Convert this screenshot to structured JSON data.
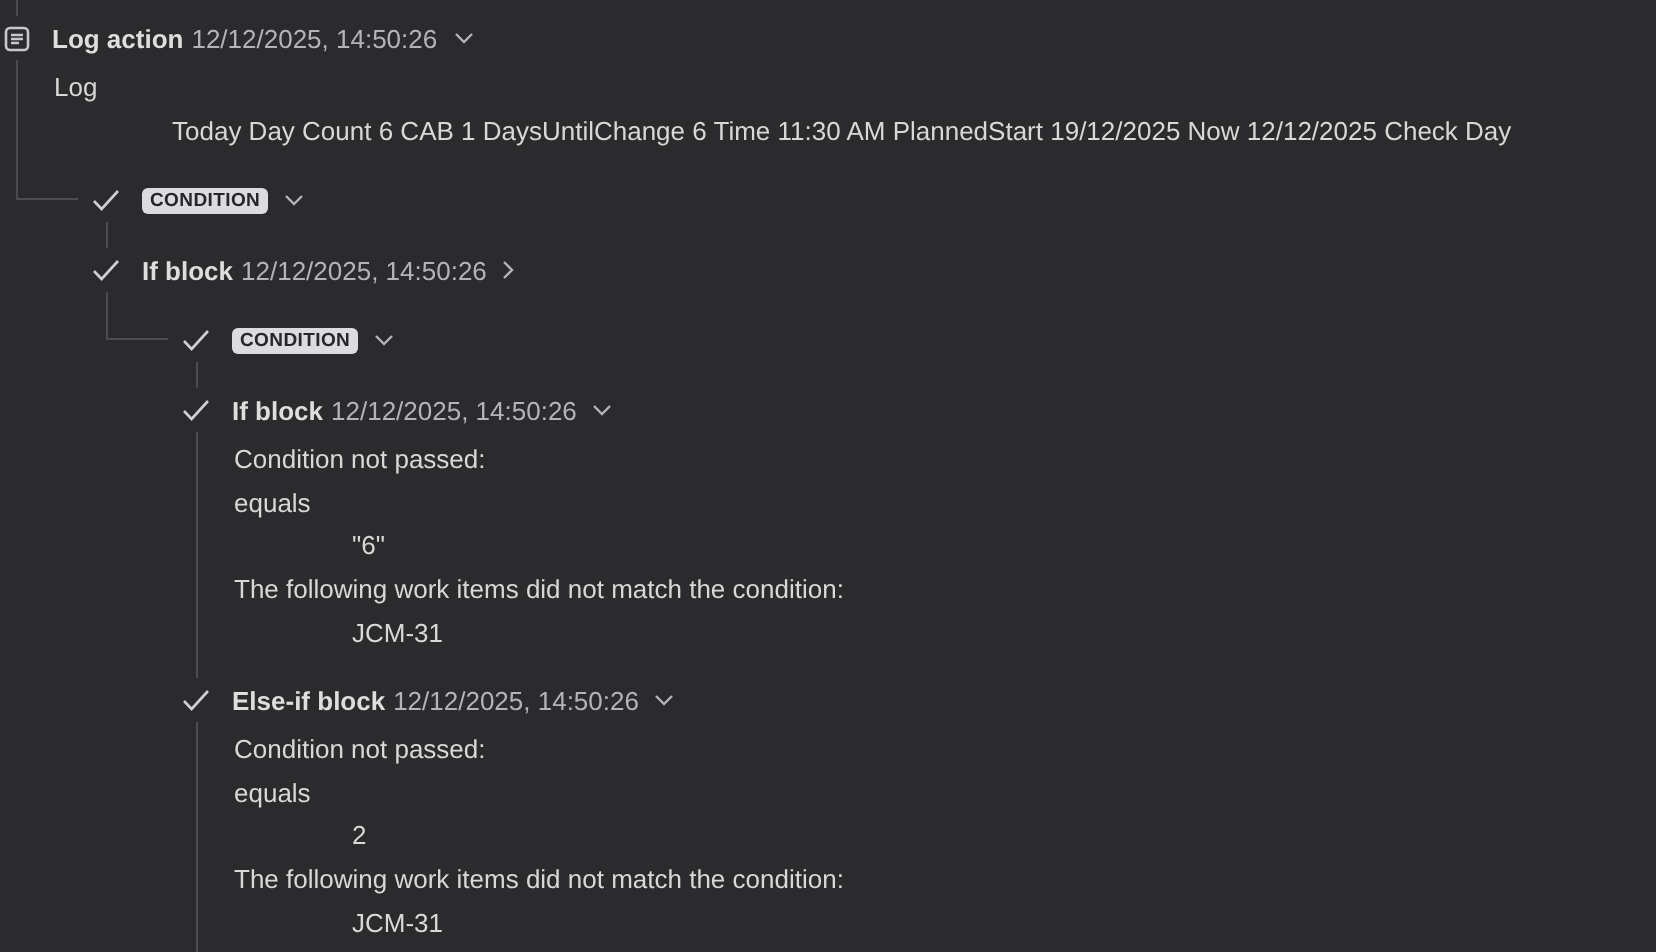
{
  "log": {
    "kind": "log",
    "title": "Log action",
    "timestamp": "12/12/2025, 14:50:26",
    "expanded": true,
    "details": [
      {
        "kind": "text",
        "text": "Log"
      },
      {
        "kind": "value",
        "text": "Today Day Count 6 CAB 1 DaysUntilChange 6 Time 11:30 AM PlannedStart 19/12/2025 Now 12/12/2025 Check Day"
      }
    ],
    "children": [
      {
        "kind": "condition",
        "badge": "CONDITION",
        "expanded": true,
        "children": [
          {
            "kind": "block",
            "title": "If block",
            "timestamp": "12/12/2025, 14:50:26",
            "expanded": false,
            "children": [
              {
                "kind": "condition",
                "badge": "CONDITION",
                "expanded": true,
                "children": [
                  {
                    "kind": "block",
                    "title": "If block",
                    "timestamp": "12/12/2025, 14:50:26",
                    "expanded": true,
                    "details": [
                      {
                        "kind": "text",
                        "text": "Condition not passed:"
                      },
                      {
                        "kind": "text",
                        "text": "equals"
                      },
                      {
                        "kind": "value",
                        "text": "\"6\""
                      },
                      {
                        "kind": "text",
                        "text": "The following work items did not match the condition:"
                      },
                      {
                        "kind": "value",
                        "text": "JCM-31"
                      }
                    ]
                  },
                  {
                    "kind": "block",
                    "title": "Else-if block",
                    "timestamp": "12/12/2025, 14:50:26",
                    "expanded": true,
                    "details": [
                      {
                        "kind": "text",
                        "text": "Condition not passed:"
                      },
                      {
                        "kind": "text",
                        "text": "equals"
                      },
                      {
                        "kind": "value",
                        "text": "2"
                      },
                      {
                        "kind": "text",
                        "text": "The following work items did not match the condition:"
                      },
                      {
                        "kind": "value",
                        "text": "JCM-31"
                      }
                    ]
                  }
                ]
              }
            ]
          }
        ]
      }
    ]
  }
}
